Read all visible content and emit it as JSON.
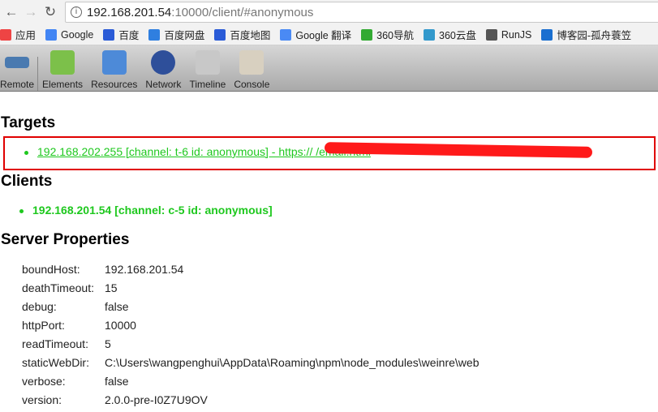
{
  "browser": {
    "url_host": "192.168.201.54",
    "url_path": ":10000/client/#anonymous",
    "bookmarks": [
      {
        "label": "应用",
        "color": "#e44"
      },
      {
        "label": "Google",
        "color": "#4285f4"
      },
      {
        "label": "百度",
        "color": "#2a5bd7"
      },
      {
        "label": "百度网盘",
        "color": "#2f7fe0"
      },
      {
        "label": "百度地图",
        "color": "#2a5bd7"
      },
      {
        "label": "Google 翻译",
        "color": "#4a8af4"
      },
      {
        "label": "360导航",
        "color": "#3a3"
      },
      {
        "label": "360云盘",
        "color": "#39c"
      },
      {
        "label": "RunJS",
        "color": "#555"
      },
      {
        "label": "博客园-孤舟蓑笠",
        "color": "#1a6fd0"
      }
    ]
  },
  "toolbar": [
    {
      "label": "Remote",
      "icon": "weinre-logo-icon"
    },
    {
      "label": "Elements",
      "icon": "elements-icon"
    },
    {
      "label": "Resources",
      "icon": "resources-icon"
    },
    {
      "label": "Network",
      "icon": "network-icon"
    },
    {
      "label": "Timeline",
      "icon": "timeline-icon"
    },
    {
      "label": "Console",
      "icon": "console-icon"
    }
  ],
  "targets": {
    "title": "Targets",
    "items": [
      "192.168.202.255 [channel: t-6 id: anonymous] - https://                                                                              /email.html"
    ]
  },
  "clients": {
    "title": "Clients",
    "items": [
      "192.168.201.54 [channel: c-5 id: anonymous]"
    ]
  },
  "server": {
    "title": "Server Properties",
    "props": [
      {
        "k": "boundHost:",
        "v": "192.168.201.54"
      },
      {
        "k": "deathTimeout:",
        "v": "15"
      },
      {
        "k": "debug:",
        "v": "false"
      },
      {
        "k": "httpPort:",
        "v": "10000"
      },
      {
        "k": "readTimeout:",
        "v": "5"
      },
      {
        "k": "staticWebDir:",
        "v": "C:\\Users\\wangpenghui\\AppData\\Roaming\\npm\\node_modules\\weinre\\web"
      },
      {
        "k": "verbose:",
        "v": "false"
      },
      {
        "k": "version:",
        "v": "2.0.0-pre-I0Z7U9OV"
      }
    ]
  },
  "colors": {
    "link": "#1ec81e",
    "highlight_box": "#e00000"
  }
}
